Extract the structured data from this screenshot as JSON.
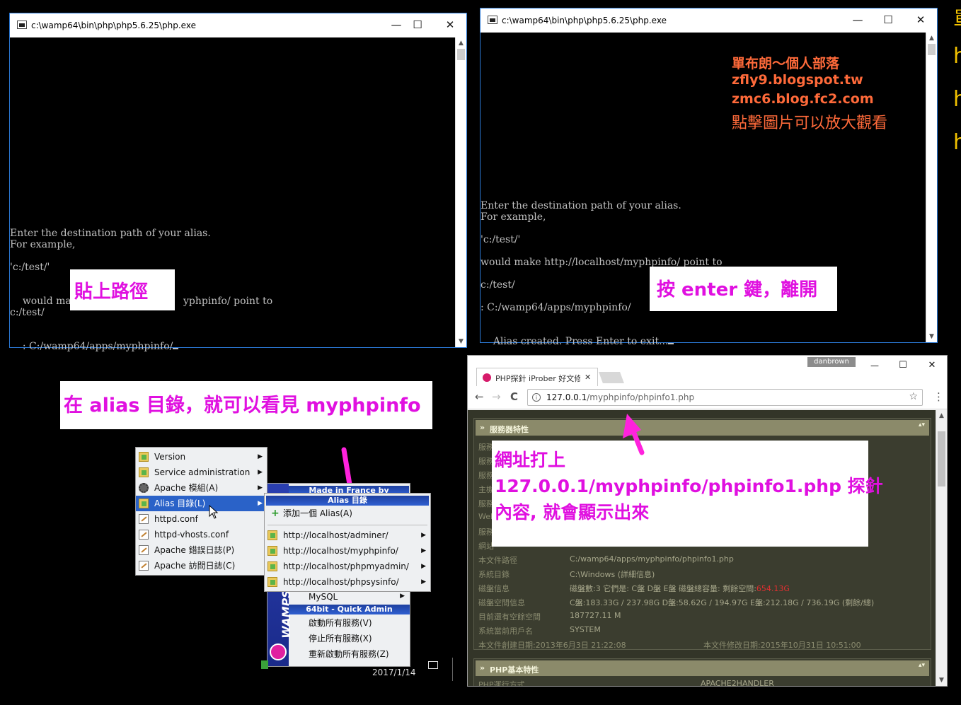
{
  "console1": {
    "title": "c:\\wamp64\\bin\\php\\php5.6.25\\php.exe",
    "minimize": "—",
    "maximize": "☐",
    "close": "✕",
    "line1": "Enter the destination path of your alias.",
    "line2": "For example,",
    "line3": "'c:/test/'",
    "line4a": "would make ",
    "line4b": "yphpinfo/ point to",
    "line5": "c:/test/",
    "line6": ": C:/wamp64/apps/myphpinfo/"
  },
  "console2": {
    "title": "c:\\wamp64\\bin\\php\\php5.6.25\\php.exe",
    "minimize": "—",
    "maximize": "☐",
    "close": "✕",
    "line1": "Enter the destination path of your alias.",
    "line2": "For example,",
    "line3": "'c:/test/'",
    "line4": "would make http://localhost/myphpinfo/ point to",
    "line5": "c:/test/",
    "line6": ": C:/wamp64/apps/myphpinfo/",
    "line7": "Alias created. Press Enter to exit..."
  },
  "watermark": {
    "l1": "單布朗〜個人部落",
    "l2": "zfly9.blogspot.tw",
    "l3": "zmc6.blog.fc2.com",
    "l4": "點擊圖片可以放大觀看"
  },
  "edge_chars": [
    "單",
    "h",
    "h",
    "h"
  ],
  "labels": {
    "paste_path": "貼上路徑",
    "press_enter": "按 enter 鍵，離開",
    "alias_dir": "在 alias 目錄，就可以看見 myphpinfo",
    "url_l1": "網址打上",
    "url_l2": "127.0.0.1/myphpinfo/phpinfo1.php 探針",
    "url_l3": "內容, 就會顯示出來"
  },
  "browser": {
    "user_badge": "danbrown",
    "tab_title": "PHP探針 iProber 好文修",
    "tab_close": "✕",
    "url_host": "127.0.0.1",
    "url_path": "/myphpinfo/phpinfo1.php",
    "back": "←",
    "forward": "→",
    "reload": "C",
    "star": "☆",
    "menu": "⋮",
    "minimize": "—",
    "maximize": "☐",
    "close": "✕",
    "section1": "服務器特性",
    "left_keys": [
      "服務",
      "服務",
      "服務",
      "主機",
      "服務",
      "Web",
      "服務",
      "網站"
    ],
    "rows": [
      {
        "k": "本文件路徑",
        "v": "C:/wamp64/apps/myphpinfo/phpinfo1.php"
      },
      {
        "k": "系統目錄",
        "v": "C:\\Windows (詳細信息)"
      },
      {
        "k": "磁盤信息",
        "v": "磁盤數:3  它們是: C盤  D盤  E盤      磁盤總容量:  剩餘空間:",
        "v2": "654.13G"
      },
      {
        "k": "磁盤空間信息",
        "v": "C盤:183.33G / 237.98G      D盤:58.62G / 194.97G      E盤:212.18G / 736.19G      (剩餘/總)"
      },
      {
        "k": "目前還有空餘空間",
        "v": "187727.11 M"
      },
      {
        "k": "系統當前用戶名",
        "v": "SYSTEM"
      }
    ],
    "created": "本文件創建日期:2013年6月3日 21:22:08",
    "modified": "本文件修改日期:2015年10月31日 10:51:00",
    "section2": "PHP基本特性",
    "php_mode_k": "PHP運行方式",
    "php_mode_v": "APACHE2HANDLER"
  },
  "menu_main": {
    "items": [
      {
        "label": "Version",
        "icon": "folder-icon",
        "sub": true
      },
      {
        "label": "Service administration",
        "icon": "folder-icon",
        "sub": true
      },
      {
        "label": "Apache 模組(A)",
        "icon": "gear-icon",
        "sub": true
      },
      {
        "label": "Alias 目錄(L)",
        "icon": "folder-icon",
        "sub": true,
        "selected": true
      },
      {
        "label": "httpd.conf",
        "icon": "document-icon",
        "sub": false
      },
      {
        "label": "httpd-vhosts.conf",
        "icon": "document-icon",
        "sub": false
      },
      {
        "label": "Apache 錯誤日誌(P)",
        "icon": "document-icon",
        "sub": false
      },
      {
        "label": "Apache 訪問日誌(C)",
        "icon": "document-icon",
        "sub": false
      }
    ]
  },
  "menu_alias": {
    "made_in": "Made in France by Otomatic",
    "header": "Alias 目錄",
    "add": "添加一個 Alias(A)",
    "items": [
      "http://localhost/adminer/",
      "http://localhost/myphpinfo/",
      "http://localhost/phpmyadmin/",
      "http://localhost/phpsysinfo/"
    ]
  },
  "menu_quick": {
    "mysql": "MySQL",
    "header": "64bit - Quick Admin",
    "items": [
      "啟動所有服務(V)",
      "停止所有服務(X)",
      "重新啟動所有服務(Z)"
    ],
    "brand": "WAMPS"
  },
  "taskbar": {
    "date": "2017/1/14"
  },
  "colors": {
    "label_text": "#e010e0",
    "watermark": "#ff6a3a",
    "arrow": "#ff22dd",
    "menu_select": "#2a62c8"
  }
}
